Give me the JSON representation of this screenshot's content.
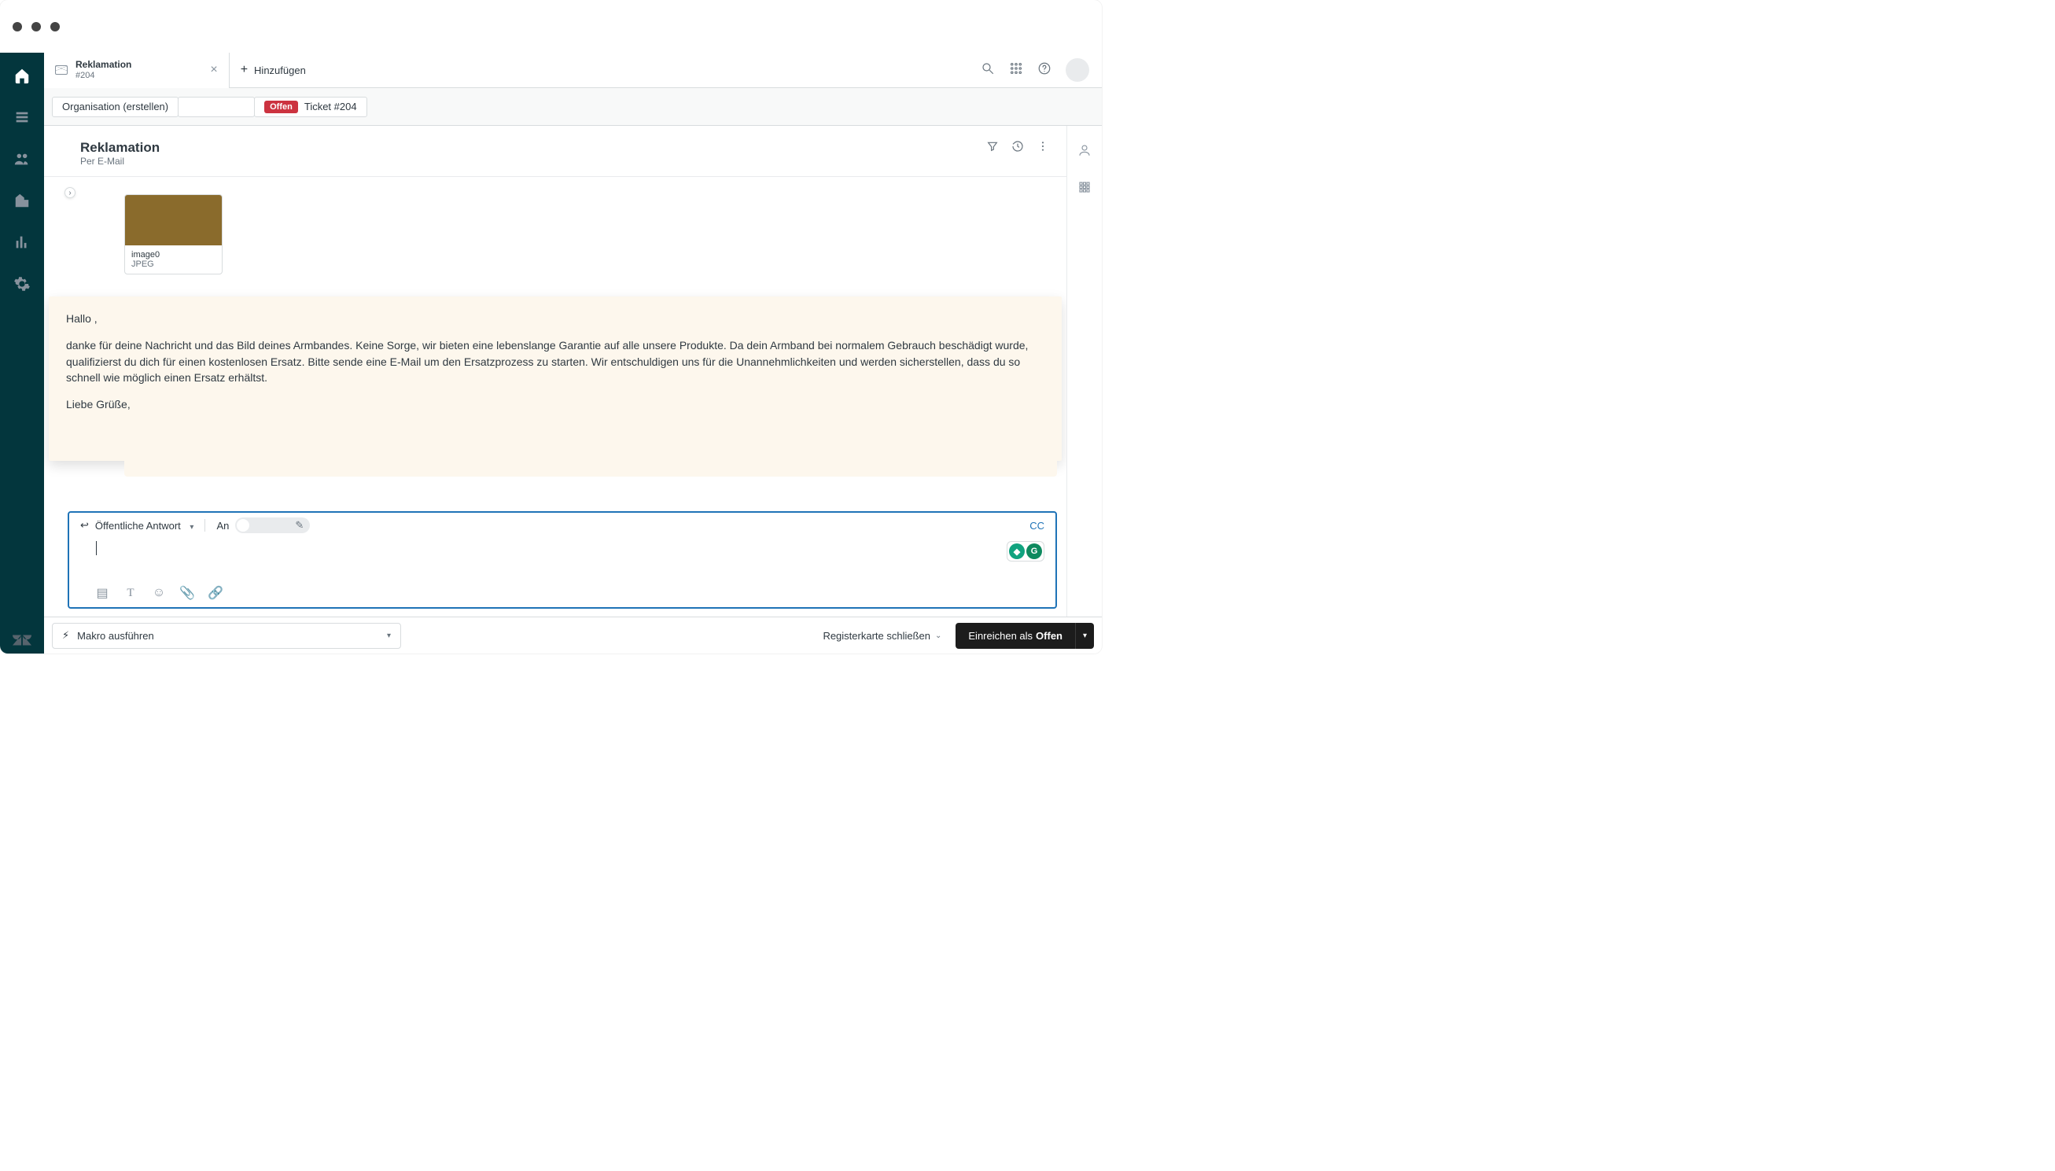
{
  "tab": {
    "title": "Reklamation",
    "subtitle": "#204",
    "add_label": "Hinzufügen"
  },
  "breadcrumb": {
    "org": "Organisation (erstellen)",
    "status": "Offen",
    "ticket": "Ticket #204"
  },
  "ticket": {
    "title": "Reklamation",
    "via": "Per E-Mail"
  },
  "attachment": {
    "name": "image0",
    "type": "JPEG"
  },
  "note": {
    "greeting": "Hallo           ,",
    "body": "danke für deine Nachricht und das Bild deines Armbandes. Keine Sorge, wir bieten eine lebenslange Garantie auf alle unsere Produkte. Da dein Armband bei normalem Gebrauch beschädigt wurde, qualifizierst du dich für einen kostenlosen Ersatz. Bitte sende eine E-Mail                                                                                                                         um den Ersatzprozess zu starten. Wir entschuldigen uns für die Unannehmlichkeiten und werden sicherstellen, dass du so schnell wie möglich einen Ersatz erhältst.",
    "signoff": "Liebe Grüße,"
  },
  "composer": {
    "mode": "Öffentliche Antwort",
    "to_label": "An",
    "cc": "CC"
  },
  "footer": {
    "macro": "Makro ausführen",
    "close_tab": "Registerkarte schließen",
    "submit_prefix": "Einreichen als",
    "submit_status": "Offen"
  }
}
